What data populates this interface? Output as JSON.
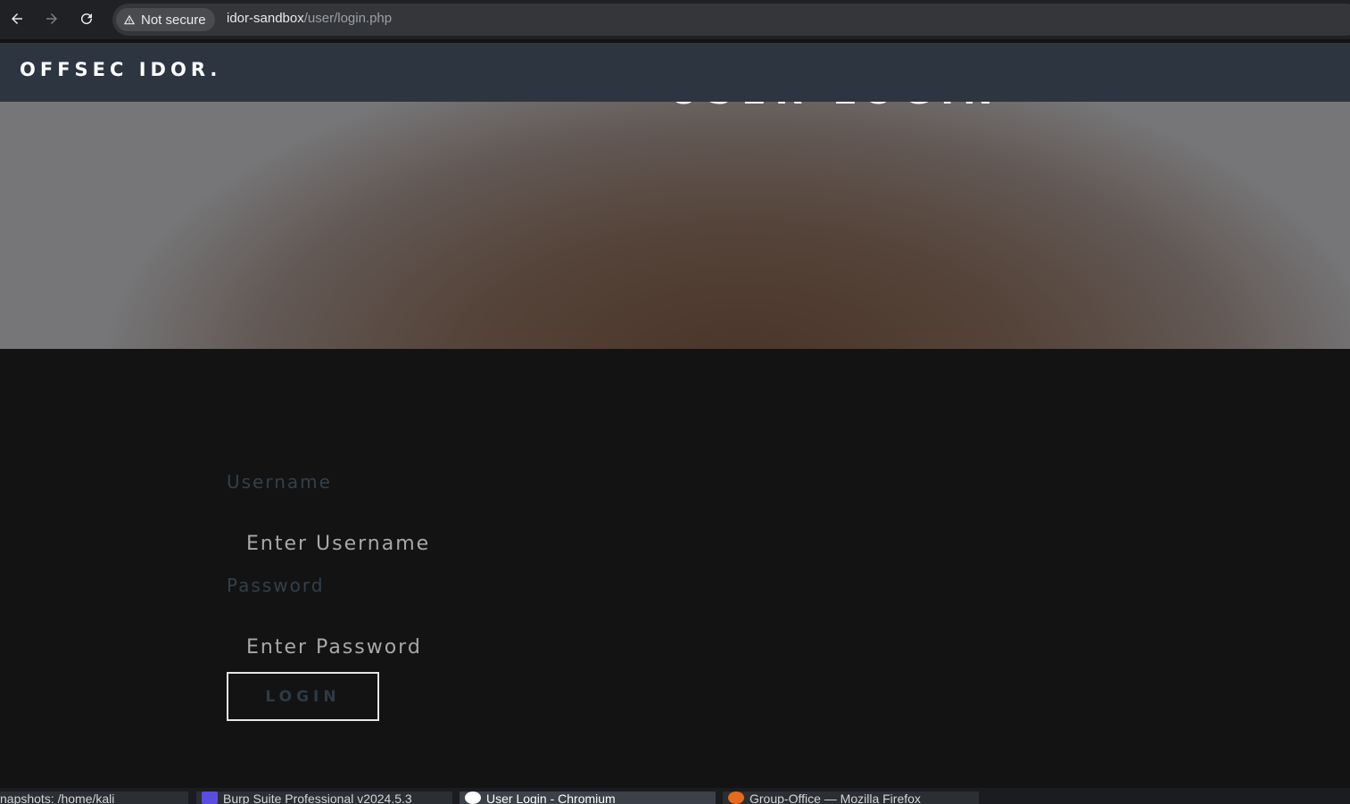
{
  "browser": {
    "security_label": "Not secure",
    "url_host": "idor-sandbox",
    "url_path": "/user/login.php"
  },
  "site": {
    "brand": "OFFSEC IDOR."
  },
  "hero": {
    "title": "USER LOGIN"
  },
  "form": {
    "username_label": "Username",
    "username_placeholder": "Enter Username",
    "password_label": "Password",
    "password_placeholder": "Enter Password",
    "login_label": "LOGIN"
  },
  "taskbar": {
    "items": [
      {
        "label": "napshots: /home/kali"
      },
      {
        "label": "Burp Suite Professional v2024.5.3"
      },
      {
        "label": "User Login - Chromium"
      },
      {
        "label": "Group-Office — Mozilla Firefox"
      }
    ]
  },
  "colors": {
    "header_bg": "#2c3540",
    "page_bg": "#131313",
    "label_color": "#33404b"
  }
}
